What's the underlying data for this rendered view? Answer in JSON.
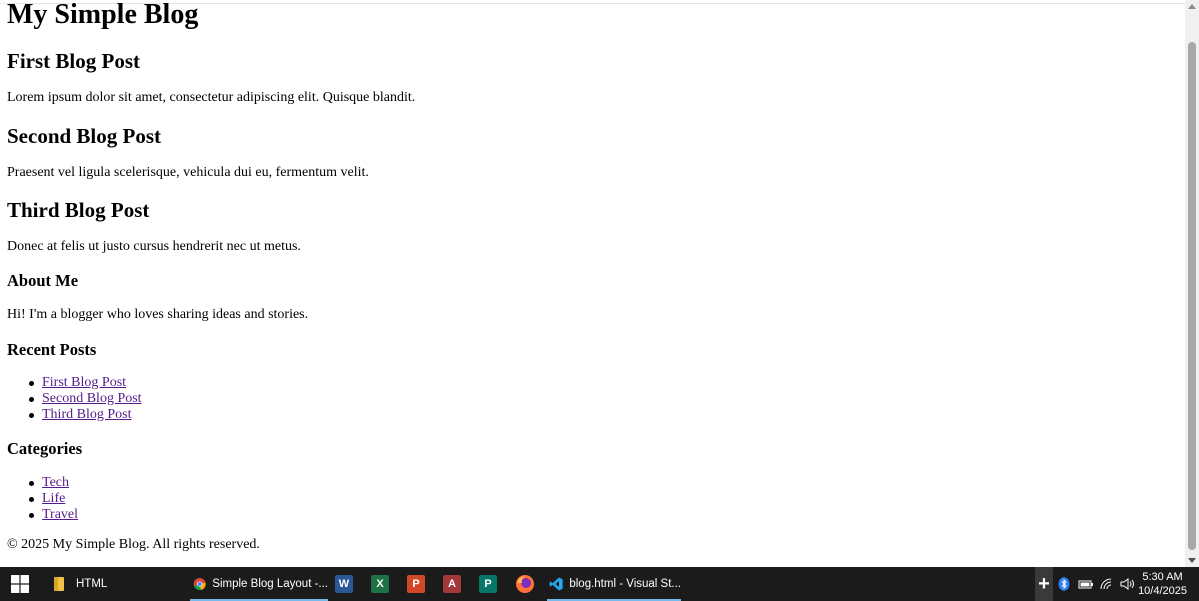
{
  "blog": {
    "title": "My Simple Blog",
    "posts": [
      {
        "title": "First Blog Post",
        "body": "Lorem ipsum dolor sit amet, consectetur adipiscing elit. Quisque blandit."
      },
      {
        "title": "Second Blog Post",
        "body": "Praesent vel ligula scelerisque, vehicula dui eu, fermentum velit."
      },
      {
        "title": "Third Blog Post",
        "body": "Donec at felis ut justo cursus hendrerit nec ut metus."
      }
    ],
    "about": {
      "heading": "About Me",
      "text": "Hi! I'm a blogger who loves sharing ideas and stories."
    },
    "recent": {
      "heading": "Recent Posts",
      "links": [
        "First Blog Post",
        "Second Blog Post",
        "Third Blog Post"
      ]
    },
    "categories": {
      "heading": "Categories",
      "links": [
        "Tech",
        "Life",
        "Travel"
      ]
    },
    "footer": "© 2025 My Simple Blog. All rights reserved."
  },
  "colors": {
    "visited_link": "#551a8b",
    "taskbar": "#1b1b1b",
    "active_indicator": "#76b9ed"
  },
  "taskbar": {
    "items": [
      {
        "label": "HTML",
        "icon": "folder-icon"
      },
      {
        "label": "Simple Blog Layout -...",
        "icon": "chrome-icon"
      },
      {
        "label": "",
        "icon": "word-icon"
      },
      {
        "label": "",
        "icon": "excel-icon"
      },
      {
        "label": "",
        "icon": "powerpoint-icon"
      },
      {
        "label": "",
        "icon": "access-icon"
      },
      {
        "label": "",
        "icon": "publisher-icon"
      },
      {
        "label": "",
        "icon": "firefox-icon"
      },
      {
        "label": "blog.html - Visual St...",
        "icon": "vscode-icon"
      }
    ],
    "word_glyph": "W",
    "excel_glyph": "X",
    "powerpoint_glyph": "P",
    "access_glyph": "A",
    "publisher_glyph": "P",
    "time": "5:30 AM",
    "date": "10/4/2025"
  }
}
